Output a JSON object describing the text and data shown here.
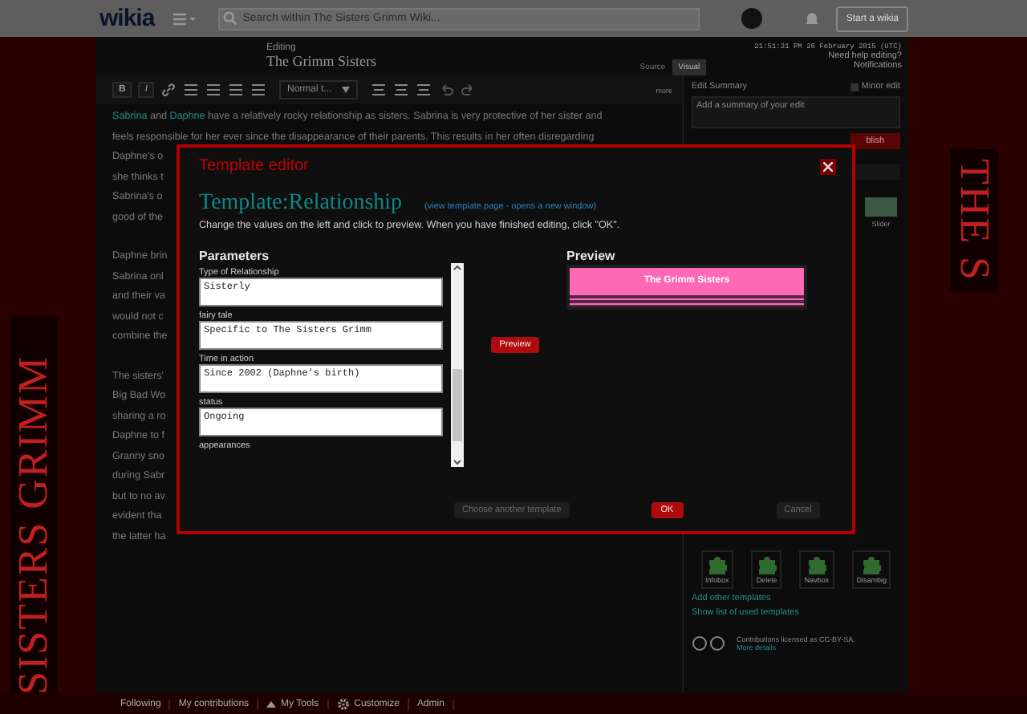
{
  "topbar": {
    "logo": "wikia",
    "search_placeholder": "Search within The Sisters Grimm Wiki...",
    "start_button": "Start a wikia"
  },
  "side_art": {
    "left": "SISTERS GRIMM",
    "right": "THE S"
  },
  "header": {
    "label": "Editing",
    "title": "The Grimm Sisters",
    "timestamp": "21:51:31 PM 26 February 2015 (UTC)",
    "help": "Need help editing?",
    "notifications": "Notifications",
    "mode_tabs": [
      {
        "label": "Source",
        "selected": false
      },
      {
        "label": "Visual",
        "selected": true
      }
    ]
  },
  "toolbar": {
    "bold": "B",
    "italic": "I",
    "format": "Normal t...",
    "more": "more"
  },
  "article": {
    "paragraphs": [
      [
        [
          {
            "text": "Sabrina",
            "link": true
          },
          {
            "text": " and ",
            "link": false
          },
          {
            "text": "Daphne",
            "link": true
          },
          {
            "text": " have a relatively rocky relationship as sisters. Sabrina is very protective of her sister and",
            "link": false
          }
        ],
        [
          {
            "text": "feels responsible for her ever since the disappearance of their parents. This results in her often disregarding",
            "link": false
          }
        ],
        [
          {
            "text": "Daphne's o",
            "link": false
          }
        ],
        [
          {
            "text": "she thinks t",
            "link": false
          }
        ],
        [
          {
            "text": "Sabrina's o",
            "link": false
          }
        ],
        [
          {
            "text": "good of the",
            "link": false
          }
        ]
      ],
      [
        [
          {
            "text": "Daphne brin",
            "link": false
          }
        ],
        [
          {
            "text": "Sabrina onl",
            "link": false
          }
        ],
        [
          {
            "text": "and their va",
            "link": false
          }
        ],
        [
          {
            "text": "would not c",
            "link": false
          }
        ],
        [
          {
            "text": "combine the",
            "link": false
          }
        ]
      ],
      [
        [
          {
            "text": "The sisters'",
            "link": false
          }
        ],
        [
          {
            "text": "Big Bad Wo",
            "link": false
          }
        ],
        [
          {
            "text": "sharing a ro",
            "link": false
          }
        ],
        [
          {
            "text": "Daphne to f",
            "link": false
          }
        ],
        [
          {
            "text": "Granny sno",
            "link": false
          }
        ],
        [
          {
            "text": "during Sabr",
            "link": false
          }
        ],
        [
          {
            "text": "but to no av",
            "link": false
          }
        ],
        [
          {
            "text": "evident tha",
            "link": false
          }
        ],
        [
          {
            "text": "the latter ha",
            "link": false
          }
        ]
      ]
    ]
  },
  "rail": {
    "summary_label": "Edit Summary",
    "minor_edit": {
      "label": "Minor edit",
      "checked": false
    },
    "summary_placeholder": "Add a summary of your edit",
    "publish": "blish",
    "slider_label": "Slider",
    "templates": [
      {
        "label": "Infobox"
      },
      {
        "label": "Delete"
      },
      {
        "label": "Navbox"
      },
      {
        "label": "Disambig"
      }
    ],
    "links": [
      "Add other templates",
      "Show list of used templates"
    ],
    "license": "Contributions licensed as CC-BY-SA.",
    "license_link": "More details"
  },
  "bottom_bar": [
    {
      "label": "Following",
      "kind": "text"
    },
    {
      "label": "My contributions",
      "kind": "text"
    },
    {
      "label": "My Tools",
      "kind": "menu"
    },
    {
      "label": "Customize",
      "kind": "gear"
    },
    {
      "label": "Admin",
      "kind": "text"
    }
  ],
  "modal": {
    "title": "Template editor",
    "template_name": "Template:Relationship",
    "template_link": "(view template page - opens a new window)",
    "instructions": "Change the values on the left and click to preview. When you have finished editing, click \"OK\".",
    "params_heading": "Parameters",
    "params": [
      {
        "label": "Type of Relationship",
        "value": "Sisterly"
      },
      {
        "label": "fairy tale",
        "value": "Specific to The Sisters Grimm"
      },
      {
        "label": "Time in action",
        "value": "Since 2002 (Daphne's birth)"
      },
      {
        "label": "status",
        "value": "Ongoing"
      },
      {
        "label": "appearances"
      }
    ],
    "preview_button": "Preview",
    "preview_heading": "Preview",
    "preview_title": "The Grimm Sisters",
    "buttons": [
      {
        "label": "Choose another template",
        "kind": "secondary",
        "disabled": true
      },
      {
        "label": "OK",
        "kind": "primary",
        "disabled": false
      },
      {
        "label": "Cancel",
        "kind": "secondary",
        "disabled": true
      }
    ]
  }
}
